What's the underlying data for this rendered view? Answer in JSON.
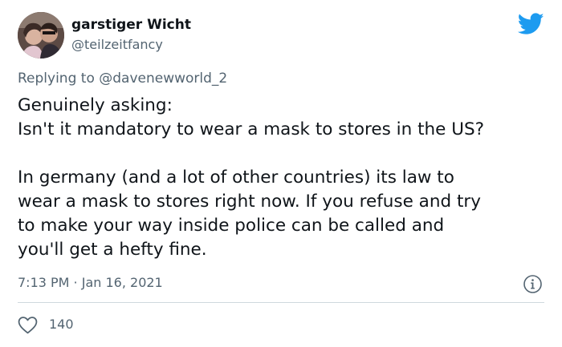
{
  "user": {
    "display_name": "garstiger Wicht",
    "handle": "@teilzeitfancy"
  },
  "reply": {
    "prefix": "Replying to",
    "mention": "@davenewworld_2"
  },
  "tweet": {
    "lines": [
      "Genuinely asking:",
      "Isn't it mandatory to wear a mask to stores in the US?",
      "",
      "In germany (and a lot of other countries) its law to",
      "wear a mask to stores right now. If you refuse and try",
      "to make your way inside police can be called and",
      "you'll get a hefty fine."
    ],
    "timestamp": "7:13 PM · Jan 16, 2021",
    "likes": "140"
  },
  "icons": {
    "brand": "twitter-bird-icon",
    "info": "info-icon",
    "like": "heart-icon"
  },
  "colors": {
    "brand": "#1d9bf0",
    "text": "#0f1419",
    "secondary": "#536471",
    "divider": "#cfd9de"
  }
}
